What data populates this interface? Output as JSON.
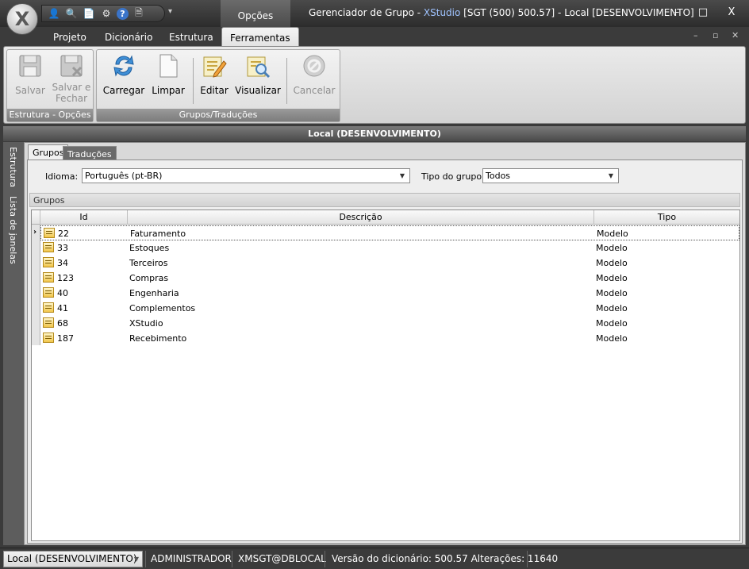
{
  "app": {
    "logo_letter": "X"
  },
  "titlebar": {
    "context_tab": "Opções",
    "title_prefix": "Gerenciador de Grupo - ",
    "title_app": "XStudio",
    "title_suffix": " [SGT (500) 500.57] - Local [DESENVOLVIMENTO]",
    "minimize": "–",
    "maximize": "□",
    "close": "X"
  },
  "quick_access": [
    {
      "name": "users-icon",
      "glyph": "👤"
    },
    {
      "name": "magnifier-icon",
      "glyph": "🔍"
    },
    {
      "name": "document-icon",
      "glyph": "📄"
    },
    {
      "name": "gear-icon",
      "glyph": "⚙"
    },
    {
      "name": "help-icon",
      "glyph": "?"
    },
    {
      "name": "info-page-icon",
      "glyph": "🗎"
    }
  ],
  "ribbon_tabs": [
    "Projeto",
    "Dicionário",
    "Estrutura",
    "Ferramentas"
  ],
  "active_ribbon_tab": "Ferramentas",
  "ribbon": {
    "groups": [
      {
        "caption": "Estrutura - Opções",
        "buttons": [
          {
            "label": "Salvar",
            "icon": "floppy-disk-icon",
            "enabled": false
          },
          {
            "label": "Salvar e\nFechar",
            "icon": "save-close-icon",
            "enabled": false
          }
        ]
      },
      {
        "caption": "Grupos/Traduções",
        "buttons": [
          {
            "label": "Carregar",
            "icon": "refresh-icon",
            "enabled": true
          },
          {
            "label": "Limpar",
            "icon": "blank-page-icon",
            "enabled": true
          },
          {
            "label": "Editar",
            "icon": "edit-icon",
            "enabled": true
          },
          {
            "label": "Visualizar",
            "icon": "preview-icon",
            "enabled": true
          },
          {
            "label": "Cancelar",
            "icon": "cancel-icon",
            "enabled": false
          }
        ]
      }
    ]
  },
  "panel_title": "Local (DESENVOLVIMENTO)",
  "side_tabs": [
    "Estrutura",
    "Lista de janelas"
  ],
  "inner_tabs": [
    "Grupos",
    "Traduções"
  ],
  "filters": {
    "idioma_label": "Idioma:",
    "idioma_value": "Português (pt-BR)",
    "tipo_label": "Tipo do grupo:",
    "tipo_value": "Todos"
  },
  "group_box_title": "Grupos",
  "grid": {
    "columns": [
      "Id",
      "Descrição",
      "Tipo"
    ],
    "rows": [
      {
        "id": "22",
        "descricao": "Faturamento",
        "tipo": "Modelo"
      },
      {
        "id": "33",
        "descricao": "Estoques",
        "tipo": "Modelo"
      },
      {
        "id": "34",
        "descricao": "Terceiros",
        "tipo": "Modelo"
      },
      {
        "id": "123",
        "descricao": "Compras",
        "tipo": "Modelo"
      },
      {
        "id": "40",
        "descricao": "Engenharia",
        "tipo": "Modelo"
      },
      {
        "id": "41",
        "descricao": "Complementos",
        "tipo": "Modelo"
      },
      {
        "id": "68",
        "descricao": "XStudio",
        "tipo": "Modelo"
      },
      {
        "id": "187",
        "descricao": "Recebimento",
        "tipo": "Modelo"
      }
    ]
  },
  "statusbar": {
    "connection": "Local (DESENVOLVIMENTO)",
    "user": "ADMINISTRADOR",
    "database": "XMSGT@DBLOCAL",
    "version": "Versão do dicionário: 500.57 Alterações: 11640"
  },
  "colors": {
    "accent_blue": "#3a74c9",
    "title_app": "#9fc3ff"
  }
}
